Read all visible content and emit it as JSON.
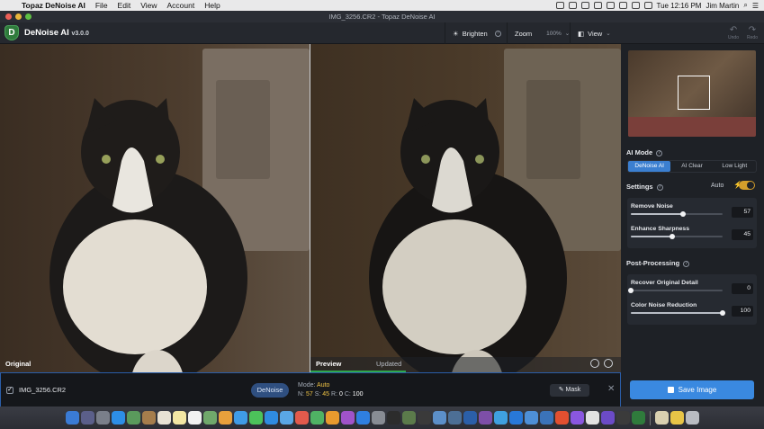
{
  "menubar": {
    "app_name": "Topaz DeNoise AI",
    "menus": [
      "File",
      "Edit",
      "View",
      "Account",
      "Help"
    ],
    "clock": "Tue 12:16 PM",
    "user": "Jim Martin"
  },
  "window": {
    "title": "IMG_3256.CR2 - Topaz DeNoise AI"
  },
  "toolbar": {
    "app_name": "DeNoise AI",
    "version": "v3.0.0",
    "brighten_label": "Brighten",
    "zoom_label": "Zoom",
    "zoom_value": "100%",
    "view_label": "View",
    "undo_label": "Undo",
    "redo_label": "Redo"
  },
  "panes": {
    "original_label": "Original",
    "preview_label": "Preview",
    "preview_status": "Updated"
  },
  "bottom": {
    "filename": "IMG_3256.CR2",
    "denoise_label": "DeNoise",
    "mode_label": "Mode:",
    "mode_value": "Auto",
    "n_label": "N:",
    "n_value": "57",
    "s_label": "S:",
    "s_value": "45",
    "r_label": "R:",
    "r_value": "0",
    "c_label": "C:",
    "c_value": "100",
    "mask_label": "Mask"
  },
  "sidebar": {
    "ai_mode_title": "AI Mode",
    "modes": [
      "DeNoise AI",
      "AI Clear",
      "Low Light"
    ],
    "active_mode": "DeNoise AI",
    "settings_title": "Settings",
    "auto_label": "Auto",
    "auto_enabled": true,
    "sliders": [
      {
        "label": "Remove Noise",
        "value": "57",
        "level": 0.57
      },
      {
        "label": "Enhance Sharpness",
        "value": "45",
        "level": 0.45
      }
    ],
    "post_title": "Post-Processing",
    "post_sliders": [
      {
        "label": "Recover Original Detail",
        "value": "0",
        "level": 0.0
      },
      {
        "label": "Color Noise Reduction",
        "value": "100",
        "level": 1.0
      }
    ],
    "save_label": "Save Image"
  },
  "colors": {
    "accent": "#3a89e0",
    "brand_green": "#2f7b3c",
    "status_green": "#2fa84f",
    "toggle": "#d39e2b"
  }
}
